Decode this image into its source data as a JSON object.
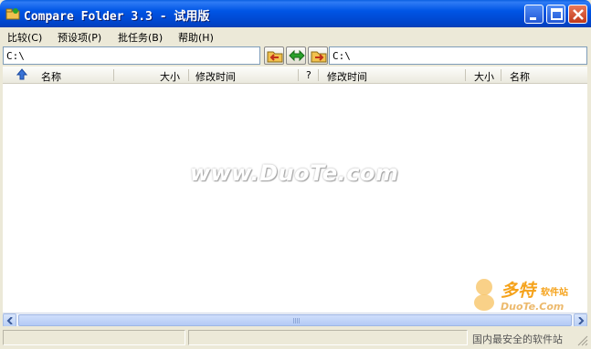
{
  "window": {
    "title": "Compare Folder 3.3 - 试用版"
  },
  "menu": {
    "items": [
      "比较(C)",
      "预设项(P)",
      "批任务(B)",
      "帮助(H)"
    ]
  },
  "paths": {
    "left": "C:\\",
    "right": "C:\\"
  },
  "header": {
    "left_name": "名称",
    "left_size": "大小",
    "left_modified": "修改时间",
    "compare_mark": "?",
    "right_modified": "修改时间",
    "right_size": "大小",
    "right_name": "名称"
  },
  "watermark": {
    "text": "www.DuoTe.com"
  },
  "brand": {
    "cn": "多特",
    "cn_small": "软件站",
    "en": "DuoTe.Com",
    "tagline": "国内最安全的软件站"
  },
  "icons": {
    "app": "app-icon",
    "minimize": "minimize-icon",
    "maximize": "maximize-icon",
    "close": "close-icon",
    "open_left": "folder-arrow-left-icon",
    "swap": "swap-arrows-icon",
    "open_right": "folder-arrow-right-icon",
    "sort_up": "arrow-up-icon"
  },
  "colors": {
    "titlebar": "#0055e5",
    "close": "#c1391a",
    "swap": "#2aa12a",
    "watermark_brand": "#f5a21a"
  }
}
